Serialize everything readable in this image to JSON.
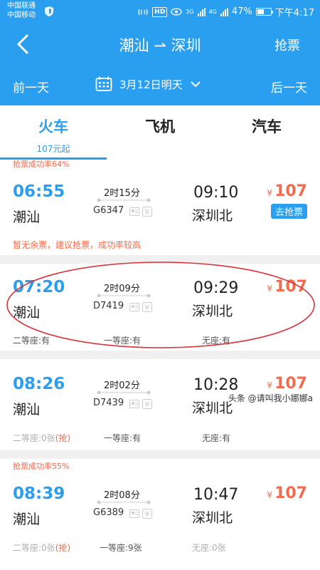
{
  "status": {
    "carrier1": "中国联通",
    "carrier2": "中国移动",
    "hd": "HD",
    "net3g": "3G",
    "net4g": "4G",
    "battery": "47%",
    "time": "下午4:17"
  },
  "nav": {
    "back_icon": "chevron-left-icon",
    "title": "潮汕 ⇀ 深圳",
    "action": "抢票"
  },
  "date_bar": {
    "prev": "前一天",
    "date": "3月12日明天",
    "next": "后一天",
    "calendar_icon": "calendar-icon",
    "dropdown_icon": "chevron-down-icon"
  },
  "tabs": [
    {
      "label": "火车",
      "sub": "107元起",
      "active": true
    },
    {
      "label": "飞机",
      "sub": "",
      "active": false
    },
    {
      "label": "汽车",
      "sub": "",
      "active": false
    }
  ],
  "colors": {
    "primary": "#2a9ff0",
    "accent": "#f26b4c",
    "highlight": "#d9343a"
  },
  "trains": [
    {
      "top_tag": "抢票成功率64%",
      "dep_time": "06:55",
      "dep_station": "潮汕",
      "duration": "2时15分",
      "train_no": "G6347",
      "arr_time": "09:10",
      "arr_station": "深圳北",
      "yen": "¥",
      "price": "107",
      "grab_button": "去抢票",
      "notice": "暂无余票，建议抢票，成功率较高"
    },
    {
      "dep_time": "07:20",
      "dep_station": "潮汕",
      "duration": "2时09分",
      "train_no": "D7419",
      "arr_time": "09:29",
      "arr_station": "深圳北",
      "yen": "¥",
      "price": "107",
      "seats": [
        "二等座:有",
        "一等座:有",
        "无座:有"
      ]
    },
    {
      "dep_time": "08:26",
      "dep_station": "潮汕",
      "duration": "2时02分",
      "train_no": "D7439",
      "arr_time": "10:28",
      "arr_station": "深圳北",
      "yen": "¥",
      "price": "107",
      "seat1": "二等座:0张",
      "seat1_grab": "(抢)",
      "seats": [
        "一等座:有",
        "无座:有"
      ]
    },
    {
      "top_tag": "抢票成功率55%",
      "dep_time": "08:39",
      "dep_station": "潮汕",
      "duration": "2时08分",
      "train_no": "G6389",
      "arr_time": "10:47",
      "arr_station": "深圳北",
      "yen": "¥",
      "price": "107",
      "seat1": "二等座:0张",
      "seat1_grab": "(抢)",
      "seats": [
        "一等座:9张",
        "无座:0张"
      ]
    }
  ],
  "watermark": "头条 @请叫我小娜娜a"
}
